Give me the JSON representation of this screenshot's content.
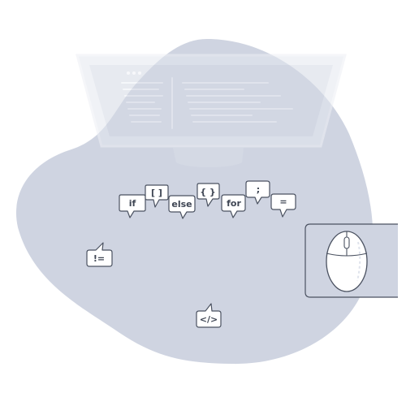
{
  "illustration": {
    "colors": {
      "blob": "#cfd4e1",
      "monitor": "#dfe3ec",
      "outline": "#4b5261",
      "bubble_fill": "#ffffff",
      "text": "#3f4654"
    },
    "code_bubbles": [
      {
        "label": "if"
      },
      {
        "label": "[ ]"
      },
      {
        "label": "else"
      },
      {
        "label": "{ }"
      },
      {
        "label": "for"
      },
      {
        "label": ";"
      },
      {
        "label": "="
      }
    ],
    "floating_bubbles": [
      {
        "label": "!="
      },
      {
        "label": "</>"
      }
    ],
    "icons": [
      "monitor-icon",
      "mouse-icon"
    ]
  }
}
